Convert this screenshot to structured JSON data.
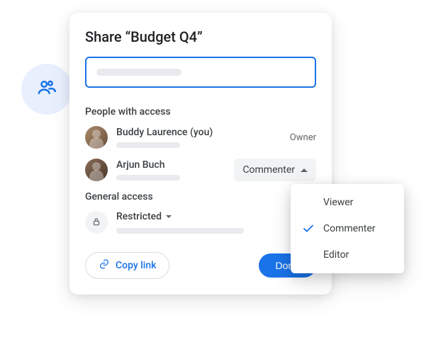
{
  "dialog": {
    "title": "Share “Budget Q4”",
    "sections": {
      "people_access_label": "People with access",
      "general_access_label": "General access"
    },
    "people": [
      {
        "name": "Buddy Laurence (you)",
        "role_label": "Owner"
      },
      {
        "name": "Arjun Buch",
        "role_dropdown": "Commenter"
      }
    ],
    "general": {
      "restricted_label": "Restricted"
    },
    "footer": {
      "copy_link_label": "Copy link",
      "done_label": "Done"
    }
  },
  "role_menu": {
    "options": [
      "Viewer",
      "Commenter",
      "Editor"
    ],
    "selected": "Commenter"
  },
  "colors": {
    "primary": "#1a73e8",
    "badge_bg": "#e8f0fe",
    "chip_bg": "#f1f3f4"
  }
}
